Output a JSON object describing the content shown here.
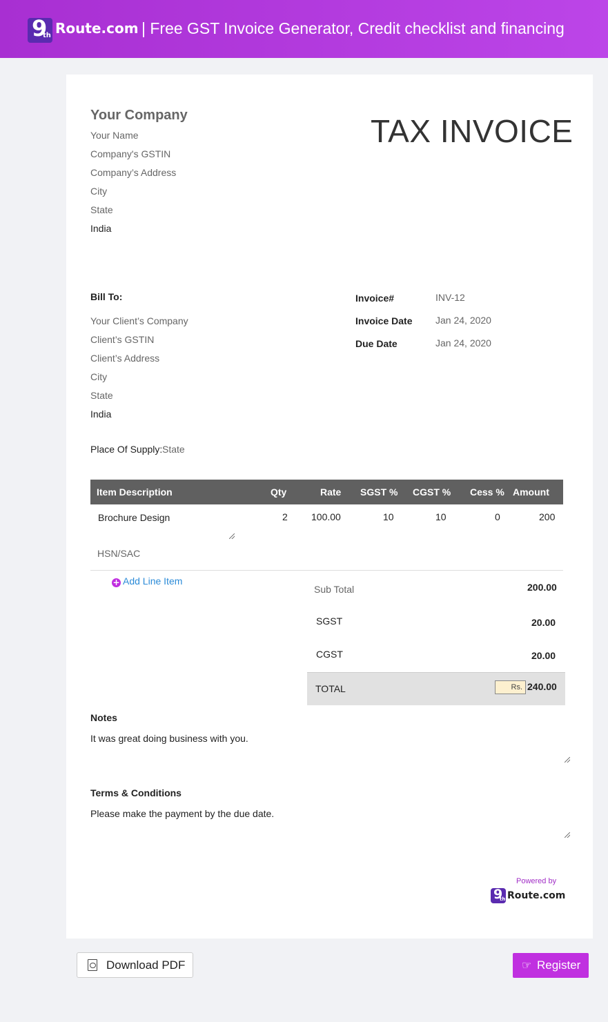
{
  "header": {
    "logo_text": "Route.com",
    "logo_number": "9",
    "logo_suffix": "th",
    "title": "| Free GST Invoice Generator, Credit checklist and financing"
  },
  "company": {
    "name": "Your Company",
    "person": "Your Name",
    "gstin": "Company's GSTIN",
    "address": "Company’s Address",
    "city": "City",
    "state": "State",
    "country": "India"
  },
  "invoice_title": "TAX INVOICE",
  "bill_to": {
    "label": "Bill To:",
    "company": "Your Client’s Company",
    "gstin": "Client’s GSTIN",
    "address": "Client’s Address",
    "city": "City",
    "state": "State",
    "country": "India"
  },
  "meta": {
    "invoice_no_label": "Invoice#",
    "invoice_no": "INV-12",
    "invoice_date_label": "Invoice Date",
    "invoice_date": "Jan 24, 2020",
    "due_date_label": "Due Date",
    "due_date": "Jan 24, 2020"
  },
  "supply": {
    "label": "Place Of Supply:",
    "value": "State"
  },
  "table": {
    "headers": [
      "Item Description",
      "Qty",
      "Rate",
      "SGST %",
      "CGST %",
      "Cess %",
      "Amount"
    ],
    "rows": [
      {
        "description": "Brochure Design",
        "qty": "2",
        "rate": "100.00",
        "sgst": "10",
        "cgst": "10",
        "cess": "0",
        "amount": "200",
        "hsn_placeholder": "HSN/SAC"
      }
    ]
  },
  "add_line_label": "Add Line Item",
  "totals": {
    "subtotal_label": "Sub Total",
    "subtotal": "200.00",
    "sgst_label": "SGST",
    "sgst": "20.00",
    "cgst_label": "CGST",
    "cgst": "20.00",
    "total_label": "TOTAL",
    "currency": "Rs.",
    "total": "240.00"
  },
  "notes": {
    "label": "Notes",
    "text": "It was great doing business with you."
  },
  "terms": {
    "label": "Terms & Conditions",
    "text": "Please make the payment by the due date."
  },
  "footer": {
    "powered_by": "Powered by",
    "logo_text": "Route.com"
  },
  "buttons": {
    "download_pdf": "Download PDF",
    "register": "Register"
  },
  "colors": {
    "brand_purple": "#c030e0",
    "table_header": "#606060",
    "link_blue": "#2b8bd8"
  }
}
